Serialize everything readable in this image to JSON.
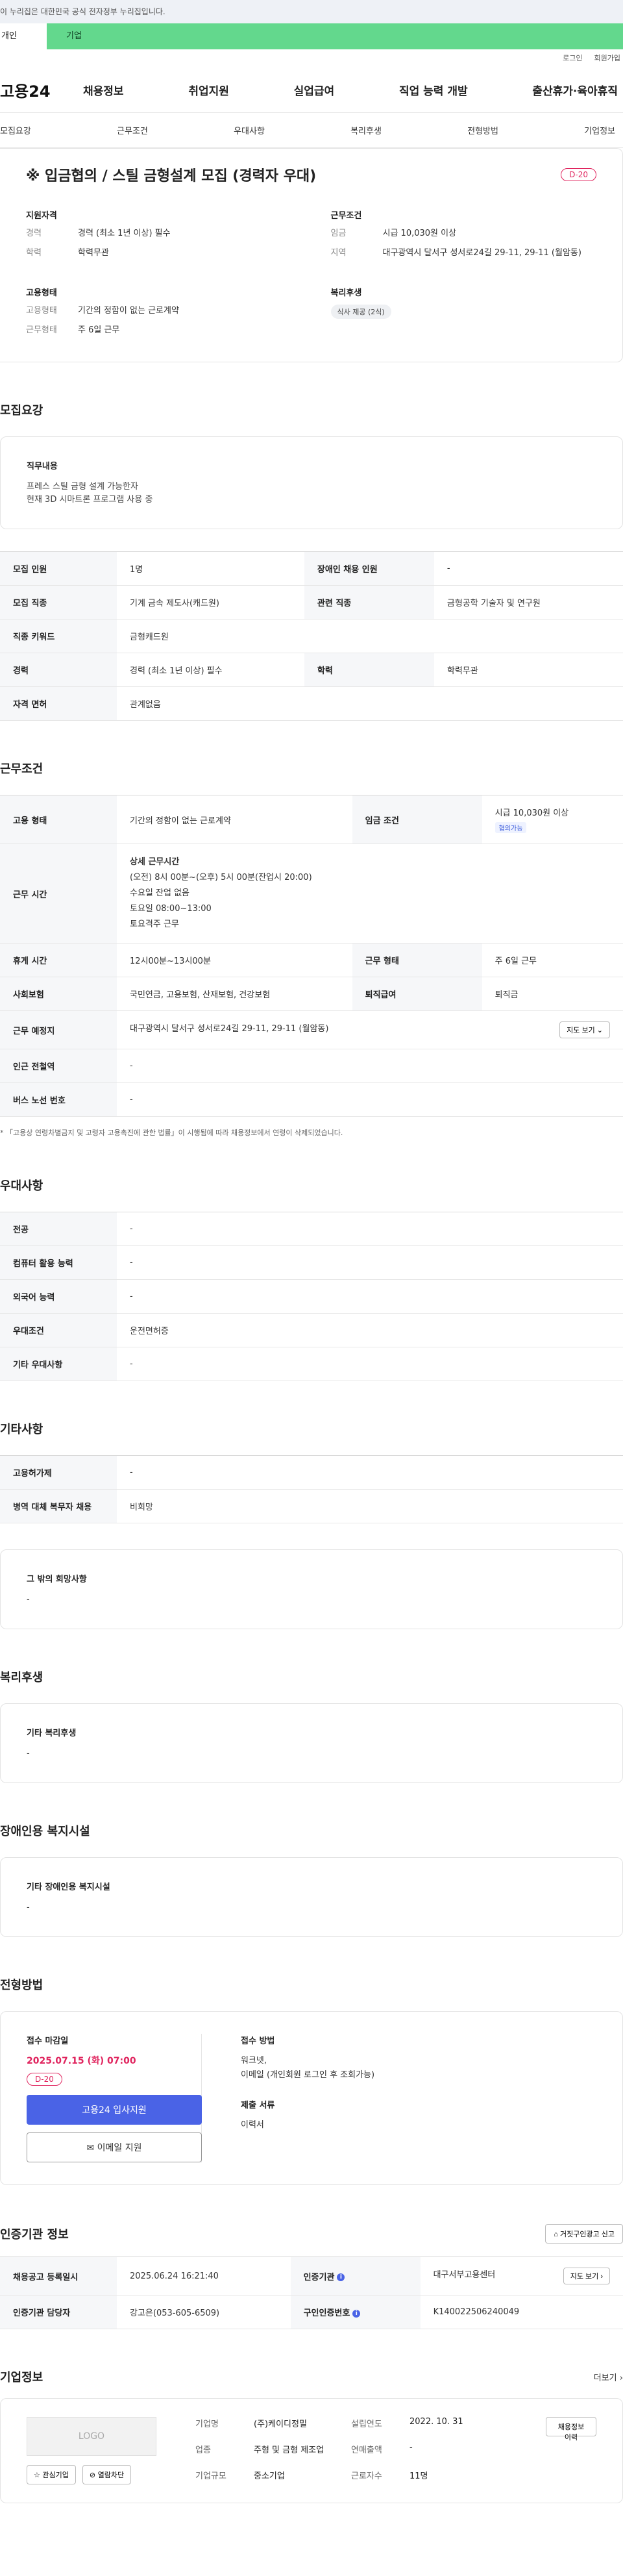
{
  "topbar": {
    "notice": "이 누리집은 대한민국 공식 전자정부 누리집입니다."
  },
  "tabs": {
    "personal": "개인",
    "company": "기업"
  },
  "utility": {
    "login": "로그인",
    "signup": "회원가입"
  },
  "gnb": {
    "logo": "고용24",
    "menu": [
      "채용정보",
      "취업지원",
      "실업급여",
      "직업 능력 개발",
      "출산휴가·육아휴직"
    ]
  },
  "anchors": [
    "모집요강",
    "근무조건",
    "우대사항",
    "복리후생",
    "전형방법",
    "기업정보"
  ],
  "summary": {
    "title": "※ 입금협의 / 스틸 금형설계 모집 (경력자 우대)",
    "dday": "D-20",
    "qualification_title": "지원자격",
    "career_k": "경력",
    "career_v": "경력 (최소 1년 이상) 필수",
    "edu_k": "학력",
    "edu_v": "학력무관",
    "employment_title": "고용형태",
    "emp_k": "고용형태",
    "emp_v": "기간의 정함이 없는 근로계약",
    "work_k": "근무형태",
    "work_v": "주 6일 근무",
    "cond_title": "근무조건",
    "wage_k": "임금",
    "wage_v": "시급 10,030원 이상",
    "region_k": "지역",
    "region_v": "대구광역시 달서구 성서로24길 29-11, 29-11 (월암동)",
    "welfare_title": "복리후생",
    "welfare_chip": "식사 제공 (2식)"
  },
  "recruit": {
    "section_title": "모집요강",
    "job_title": "직무내용",
    "job_lines": [
      "프레스 스틸 금형 설계 가능한자",
      "현재 3D 시마트론 프로그램 사용 중"
    ],
    "rows": {
      "persons_k": "모집 인원",
      "persons_v": "1명",
      "disabled_k": "장애인 채용 인원",
      "disabled_v": "-",
      "jobtype_k": "모집 직종",
      "jobtype_v": "기계 금속 제도사(캐드원)",
      "related_k": "관련 직종",
      "related_v": "금형공학 기술자 및 연구원",
      "keyword_k": "직종 키워드",
      "keyword_v": "금형캐드원",
      "career_k": "경력",
      "career_v": "경력 (최소 1년 이상) 필수",
      "edu_k": "학력",
      "edu_v": "학력무관",
      "license_k": "자격 면허",
      "license_v": "관계없음"
    }
  },
  "conditions": {
    "section_title": "근무조건",
    "emp_k": "고용 형태",
    "emp_v": "기간의 정함이 없는 근로계약",
    "wage_k": "임금 조건",
    "wage_v": "시급 10,030원 이상",
    "wage_badge": "협의가능",
    "hours_k": "근무 시간",
    "hours_lines": [
      "상세 근무시간",
      "(오전) 8시 00분~(오후) 5시 00분(잔업시 20:00)",
      "수요일 잔업 없음",
      "토요일 08:00~13:00",
      "토요격주 근무"
    ],
    "break_k": "휴게 시간",
    "break_v": "12시00분~13시00분",
    "worktype_k": "근무 형태",
    "worktype_v": "주 6일 근무",
    "insurance_k": "사회보험",
    "insurance_v": "국민연금, 고용보험, 산재보험, 건강보험",
    "severance_k": "퇴직급여",
    "severance_v": "퇴직금",
    "place_k": "근무 예정지",
    "place_v": "대구광역시 달서구 성서로24길 29-11, 29-11 (월암동)",
    "map_btn": "지도 보기",
    "subway_k": "인근 전철역",
    "subway_v": "-",
    "bus_k": "버스 노선 번호",
    "bus_v": "-",
    "footnote": "* 「고용상 연령차별금지 및 고령자 고용촉진에 관한 법률」이 시행됨에 따라 채용정보에서 연령이 삭제되었습니다."
  },
  "preference": {
    "section_title": "우대사항",
    "major_k": "전공",
    "major_v": "-",
    "computer_k": "컴퓨터 활용 능력",
    "computer_v": "-",
    "language_k": "외국어 능력",
    "language_v": "-",
    "cond_k": "우대조건",
    "cond_v": "운전면허증",
    "etc_k": "기타 우대사항",
    "etc_v": "-"
  },
  "others": {
    "section_title": "기타사항",
    "permit_k": "고용허가제",
    "permit_v": "-",
    "military_k": "병역 대체 복무자 채용",
    "military_v": "비희망",
    "etc_title": "그 밖의 희망사항",
    "etc_v": "-"
  },
  "welfare": {
    "section_title": "복리후생",
    "etc_title": "기타 복리후생",
    "etc_v": "-"
  },
  "facility": {
    "section_title": "장애인용 복지시설",
    "etc_title": "기타 장애인용 복지시설",
    "etc_v": "-"
  },
  "apply": {
    "section_title": "전형방법",
    "deadline_title": "접수 마감일",
    "deadline_v": "2025.07.15 (화) 07:00",
    "dday": "D-20",
    "apply_btn": "고용24 입사지원",
    "email_btn": "이메일 지원",
    "method_title": "접수 방법",
    "method_lines": [
      "워크넷,",
      "이메일 (개인회원 로그인 후 조회가능)"
    ],
    "docs_title": "제출 서류",
    "docs_v": "이력서"
  },
  "agency": {
    "section_title": "인증기관 정보",
    "report_btn": "거짓구인광고 신고",
    "reg_k": "채용공고 등록일시",
    "reg_v": "2025.06.24 16:21:40",
    "org_k": "인증기관",
    "org_v": "대구서부고용센터",
    "map_btn": "지도 보기",
    "manager_k": "인증기관 담당자",
    "manager_v": "강고은(053-605-6509)",
    "cert_k": "구인인증번호",
    "cert_v": "K140022506240049"
  },
  "company": {
    "section_title": "기업정보",
    "more": "더보기",
    "logo": "LOGO",
    "fav_btn": "관심기업",
    "block_btn": "열람차단",
    "name_k": "기업명",
    "name_v": "(주)케이디정밀",
    "year_k": "설립연도",
    "year_v": "2022. 10. 31",
    "industry_k": "업종",
    "industry_v": "주형 및 금형 제조업",
    "sales_k": "연매출액",
    "sales_v": "-",
    "size_k": "기업규모",
    "size_v": "중소기업",
    "employees_k": "근로자수",
    "employees_v": "11명",
    "history_btn": "채용정보 이력"
  }
}
